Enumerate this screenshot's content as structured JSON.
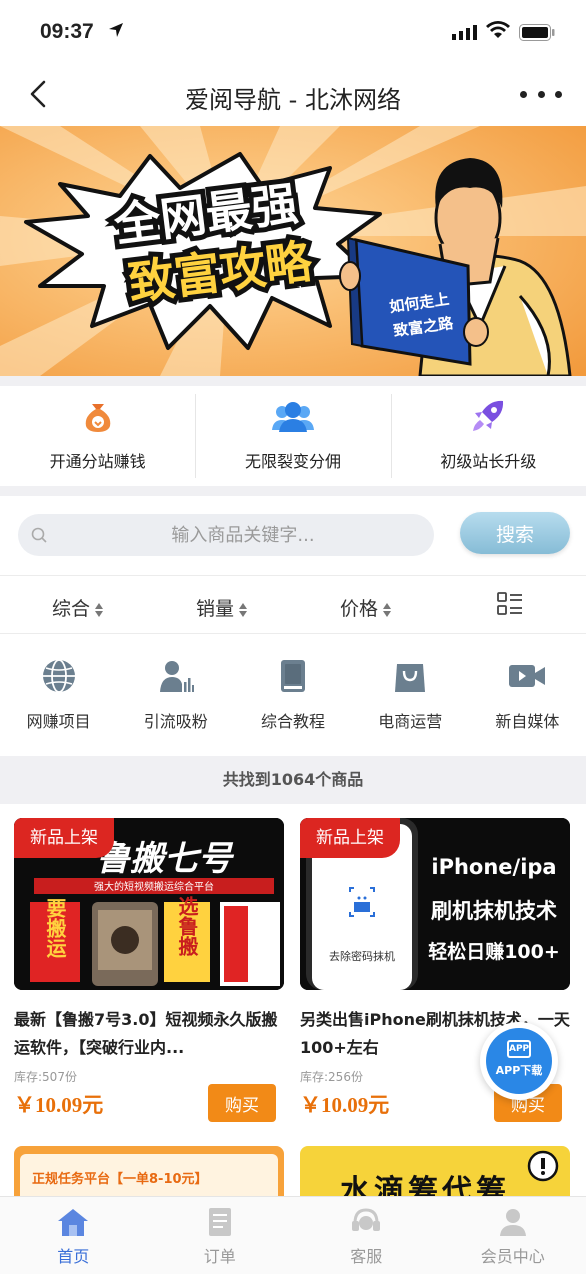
{
  "status_bar": {
    "time": "09:37"
  },
  "nav": {
    "title": "爱阅导航 - 北沐网络"
  },
  "banner": {
    "headline_1": "全网最强",
    "headline_2": "致富攻略",
    "book_text_1": "如何走上",
    "book_text_2": "致富之路"
  },
  "features": [
    {
      "label": "开通分站赚钱",
      "icon": "money-bag-icon"
    },
    {
      "label": "无限裂变分佣",
      "icon": "users-icon"
    },
    {
      "label": "初级站长升级",
      "icon": "rocket-icon"
    }
  ],
  "search": {
    "placeholder": "输入商品关键字...",
    "button_label": "搜索"
  },
  "sort": {
    "items": [
      "综合",
      "销量",
      "价格"
    ]
  },
  "categories": [
    {
      "label": "网赚项目",
      "icon": "globe-icon"
    },
    {
      "label": "引流吸粉",
      "icon": "user-chart-icon"
    },
    {
      "label": "综合教程",
      "icon": "book-icon"
    },
    {
      "label": "电商运营",
      "icon": "shopping-bag-icon"
    },
    {
      "label": "新自媒体",
      "icon": "video-camera-icon"
    }
  ],
  "result_text": "共找到1064个商品",
  "products": [
    {
      "badge": "新品上架",
      "image_text_1": "鲁搬七号",
      "image_text_2": "强大的短视频搬运综合平台",
      "image_side_left": "要搬运",
      "image_side_right": "选鲁搬",
      "title": "最新【鲁搬7号3.0】短视频永久版搬运软件，【突破行业内...",
      "stock": "库存:507份",
      "price": "￥10.09元",
      "buy_label": "购买"
    },
    {
      "badge": "新品上架",
      "image_text_1": "iPhone/ipa",
      "image_text_2": "刷机抹机技术",
      "image_text_3": "轻松日赚100+",
      "image_phone_text": "去除密码抹机",
      "title": "另类出售iPhone刷机抹机技术，一天100+左右",
      "stock": "库存:256份",
      "price": "￥10.09元",
      "buy_label": "购买"
    }
  ],
  "next_cards": {
    "card_1_text": "正规任务平台【一单8-10元】",
    "card_2_text": "水滴筹代筹"
  },
  "app_float": {
    "top": "APP",
    "label": "APP下载"
  },
  "tabs": [
    {
      "label": "首页",
      "icon": "home-icon",
      "active": true
    },
    {
      "label": "订单",
      "icon": "order-icon",
      "active": false
    },
    {
      "label": "客服",
      "icon": "headset-icon",
      "active": false
    },
    {
      "label": "会员中心",
      "icon": "user-icon",
      "active": false
    }
  ],
  "colors": {
    "accent": "#3a6fd8",
    "price": "#e8700a",
    "badge": "#dc2621",
    "buy": "#f28a17"
  }
}
